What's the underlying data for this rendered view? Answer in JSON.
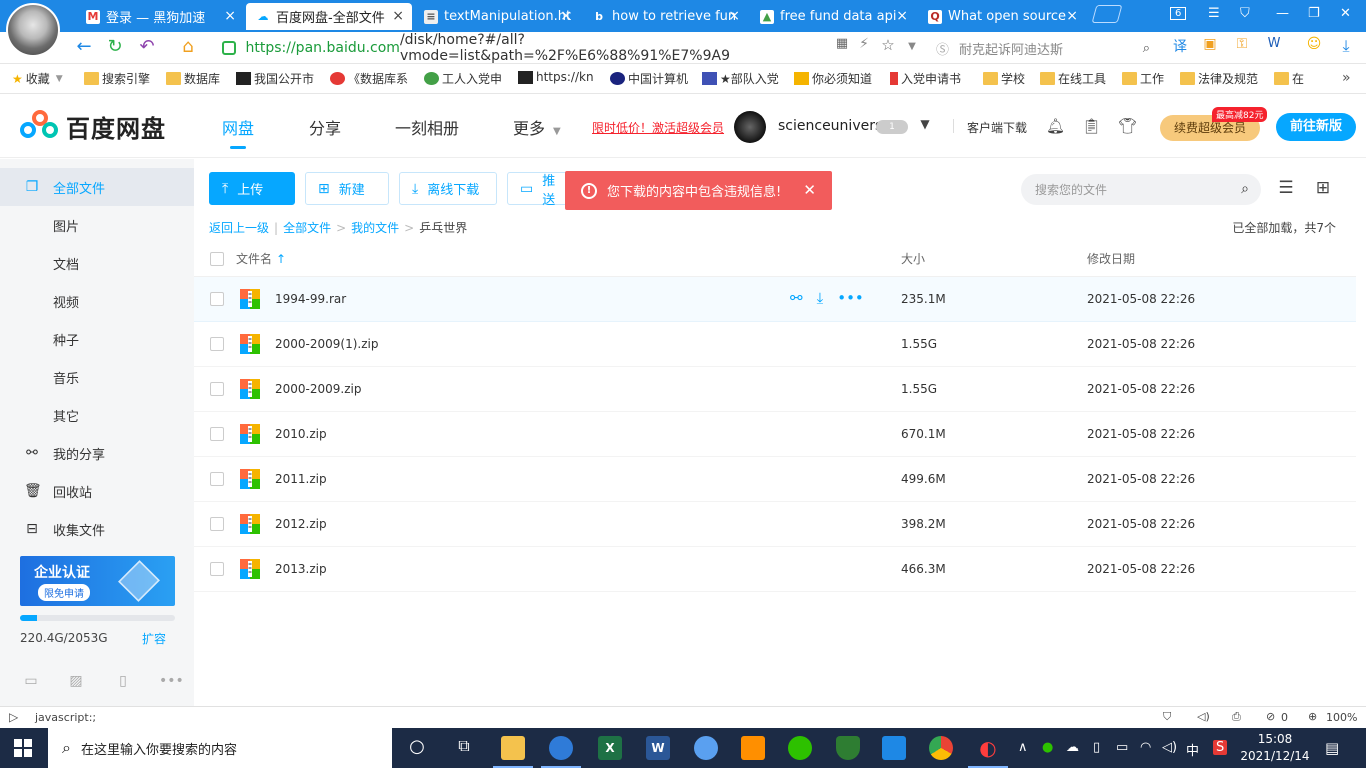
{
  "browser": {
    "tabs": [
      {
        "label": "登录 — 黑狗加速",
        "icon": "m-logo-icon",
        "active": false
      },
      {
        "label": "百度网盘-全部文件",
        "icon": "baidu-pan-icon",
        "active": true
      },
      {
        "label": "textManipulation.ht",
        "icon": "document-icon",
        "active": false
      },
      {
        "label": "how to retrieve fun",
        "icon": "bing-icon",
        "active": false
      },
      {
        "label": "free fund data api",
        "icon": "chart-icon",
        "active": false
      },
      {
        "label": "What open source",
        "icon": "quora-icon",
        "active": false
      }
    ],
    "tab_count_badge": "6",
    "url_host": "https://pan.baidu.com",
    "url_path": "/disk/home?#/all?vmode=list&path=%2F%E6%88%91%E7%9A9",
    "search_placeholder": "耐克起诉阿迪达斯",
    "bookmarks_label": "收藏",
    "bookmarks": [
      "搜索引擎",
      "数据库",
      "我国公开市",
      "《数据库系",
      "工人入党申",
      "https://kn",
      "中国计算机",
      "★部队入党",
      "你必须知道",
      "入党申请书",
      "学校",
      "在线工具",
      "工作",
      "法律及规范",
      "在"
    ],
    "status_text": "javascript:;",
    "status_count": "0",
    "zoom": "100%"
  },
  "baidupan": {
    "app_title": "百度网盘",
    "nav": [
      "网盘",
      "分享",
      "一刻相册",
      "更多"
    ],
    "promo_text": "限时低价！激活超级会员",
    "username": "scienceunivers",
    "vip_level": "1",
    "client_download": "客户端下载",
    "renew_label": "续费超级会员",
    "renew_tag": "最高减82元",
    "new_version_label": "前往新版",
    "sidebar": {
      "all_files": "全部文件",
      "sub_items": [
        "图片",
        "文档",
        "视频",
        "种子",
        "音乐",
        "其它"
      ],
      "my_share": "我的分享",
      "recycle_bin": "回收站",
      "collect_files": "收集文件"
    },
    "enterprise_banner": {
      "title": "企业认证",
      "cta": "限免申请"
    },
    "quota": {
      "used_text": "220.4G/2053G",
      "used_fraction": 0.107,
      "expand_label": "扩容"
    },
    "toolbar": {
      "upload": "上传",
      "new": "新建",
      "offline_download": "离线下载",
      "push": "推送"
    },
    "toast_message": "您下载的内容中包含违规信息!",
    "search_placeholder": "搜索您的文件",
    "breadcrumb": {
      "back": "返回上一级",
      "all_files": "全部文件",
      "my_files": "我的文件",
      "current": "乒乓世界"
    },
    "load_status": "已全部加载，共7个",
    "columns": {
      "name": "文件名",
      "size": "大小",
      "modified": "修改日期"
    },
    "files": [
      {
        "name": "1994-99.rar",
        "size": "235.1M",
        "modified": "2021-05-08 22:26"
      },
      {
        "name": "2000-2009(1).zip",
        "size": "1.55G",
        "modified": "2021-05-08 22:26"
      },
      {
        "name": "2000-2009.zip",
        "size": "1.55G",
        "modified": "2021-05-08 22:26"
      },
      {
        "name": "2010.zip",
        "size": "670.1M",
        "modified": "2021-05-08 22:26"
      },
      {
        "name": "2011.zip",
        "size": "499.6M",
        "modified": "2021-05-08 22:26"
      },
      {
        "name": "2012.zip",
        "size": "398.2M",
        "modified": "2021-05-08 22:26"
      },
      {
        "name": "2013.zip",
        "size": "466.3M",
        "modified": "2021-05-08 22:26"
      }
    ]
  },
  "taskbar": {
    "search_placeholder": "在这里输入你要搜索的内容",
    "ime_label": "中",
    "time": "15:08",
    "date": "2021/12/14"
  },
  "colors": {
    "accent": "#06a7ff",
    "toast": "#f25c5c",
    "browser_tabbar": "#1e88e5",
    "taskbar": "#1c2b45"
  }
}
